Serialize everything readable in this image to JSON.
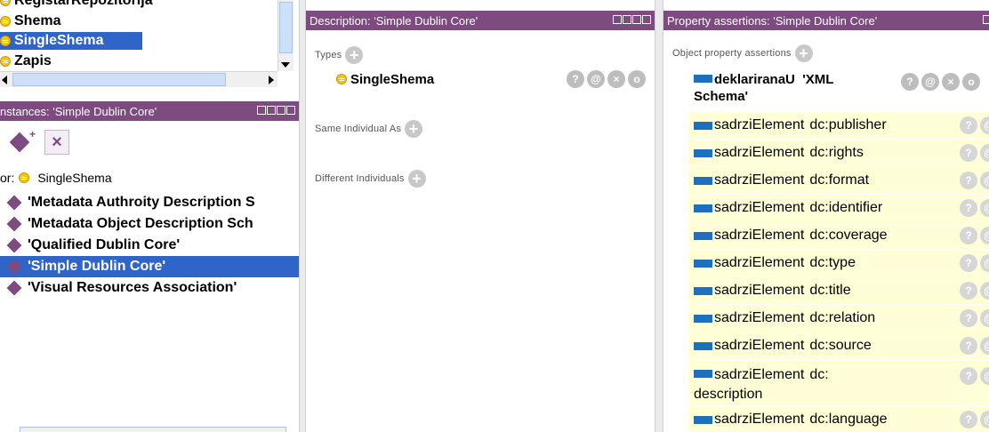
{
  "class_tree": {
    "cut_item": "RegistarRepozitorija",
    "items": [
      {
        "label": "Shema",
        "selected": false
      },
      {
        "label": "SingleShema",
        "selected": true
      },
      {
        "label": "Zapis",
        "selected": false
      }
    ]
  },
  "instances": {
    "header": "nstances: 'Simple Dublin Core'",
    "for_label": "or:",
    "for_class": "SingleShema",
    "items": [
      {
        "label": "'Metadata Authroity Description S",
        "selected": false
      },
      {
        "label": "'Metadata Object Description Sch",
        "selected": false
      },
      {
        "label": "'Qualified Dublin Core'",
        "selected": false
      },
      {
        "label": "'Simple Dublin Core'",
        "selected": true
      },
      {
        "label": "'Visual Resources Association'",
        "selected": false
      }
    ]
  },
  "description": {
    "header": "Description: 'Simple Dublin Core'",
    "types_label": "Types",
    "type_value": "SingleShema",
    "same_label": "Same Individual As",
    "different_label": "Different Individuals"
  },
  "property": {
    "header": "Property assertions: 'Simple Dublin Core'",
    "object_label": "Object property assertions",
    "first": {
      "prop": "deklariranaU",
      "value": "'XML",
      "value2": "Schema'"
    },
    "assertions": [
      {
        "prop": "sadrziElement",
        "value": "dc:publisher"
      },
      {
        "prop": "sadrziElement",
        "value": "dc:rights"
      },
      {
        "prop": "sadrziElement",
        "value": "dc:format"
      },
      {
        "prop": "sadrziElement",
        "value": "dc:identifier"
      },
      {
        "prop": "sadrziElement",
        "value": "dc:coverage"
      },
      {
        "prop": "sadrziElement",
        "value": "dc:type"
      },
      {
        "prop": "sadrziElement",
        "value": "dc:title"
      },
      {
        "prop": "sadrziElement",
        "value": "dc:relation"
      },
      {
        "prop": "sadrziElement",
        "value": "dc:source"
      },
      {
        "prop": "sadrziElement",
        "value": "dc:",
        "value2": "description"
      },
      {
        "prop": "sadrziElement",
        "value": "dc:language"
      }
    ]
  },
  "buttons": {
    "help": "?",
    "annotate": "@",
    "delete": "×",
    "edit": "o",
    "add": "+"
  },
  "colors": {
    "pane_header": "#7d4b7f",
    "selection": "#2f64c8",
    "assertion_bg": "#fffed6",
    "property_icon": "#1f6fbf",
    "class_icon": "#f4c60c"
  }
}
